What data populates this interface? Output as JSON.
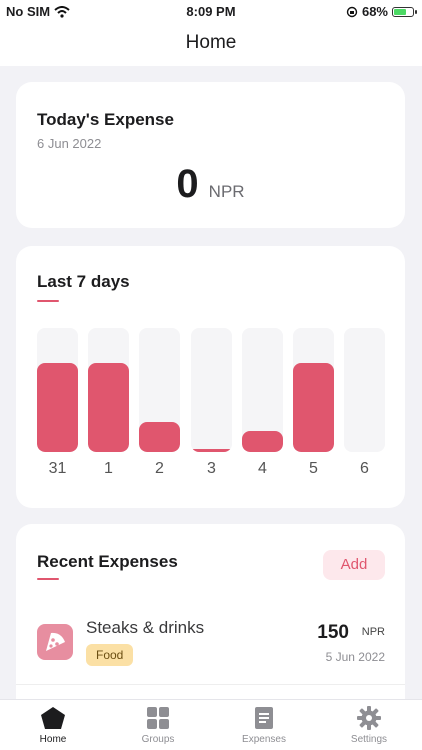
{
  "status_bar": {
    "carrier": "No SIM",
    "time": "8:09 PM",
    "battery": "68%"
  },
  "nav": {
    "title": "Home"
  },
  "today": {
    "title": "Today's Expense",
    "date": "6 Jun 2022",
    "amount": "0",
    "currency": "NPR"
  },
  "chart_data": {
    "type": "bar",
    "title": "Last 7 days",
    "categories": [
      "31",
      "1",
      "2",
      "3",
      "4",
      "5",
      "6"
    ],
    "values": [
      150,
      150,
      50,
      5,
      35,
      150,
      0
    ],
    "ylim": [
      0,
      210
    ],
    "grid": false,
    "legend": "none"
  },
  "recent": {
    "title": "Recent Expenses",
    "add_label": "Add",
    "items": [
      {
        "name": "Steaks & drinks",
        "tag": "Food",
        "amount": "150",
        "currency": "NPR",
        "date": "5 Jun 2022",
        "icon": "pizza-icon"
      }
    ]
  },
  "tabs": [
    {
      "label": "Home",
      "icon": "home-icon",
      "active": true
    },
    {
      "label": "Groups",
      "icon": "grid-icon",
      "active": false
    },
    {
      "label": "Expenses",
      "icon": "document-icon",
      "active": false
    },
    {
      "label": "Settings",
      "icon": "gear-icon",
      "active": false
    }
  ],
  "colors": {
    "accent": "#e0566e",
    "accent_soft": "#fde8ec",
    "tag_bg": "#fbe0a5",
    "icon_bg": "#e78ea0"
  }
}
